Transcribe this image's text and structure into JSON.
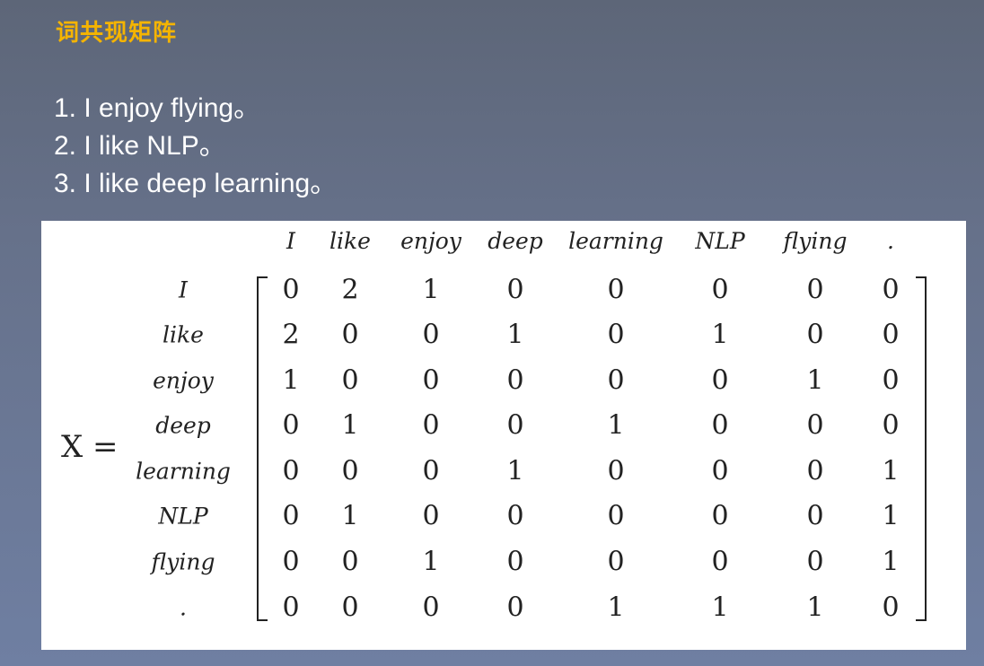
{
  "title": "词共现矩阵",
  "sentences": [
    "1. I enjoy flying。",
    "2. I like NLP。",
    "3. I like deep learning。"
  ],
  "matrix": {
    "symbol": "X =",
    "column_labels": [
      "I",
      "like",
      "enjoy",
      "deep",
      "learning",
      "NLP",
      "flying",
      "."
    ],
    "row_labels": [
      "I",
      "like",
      "enjoy",
      "deep",
      "learning",
      "NLP",
      "flying",
      "."
    ],
    "rows": [
      [
        "0",
        "2",
        "1",
        "0",
        "0",
        "0",
        "0",
        "0"
      ],
      [
        "2",
        "0",
        "0",
        "1",
        "0",
        "1",
        "0",
        "0"
      ],
      [
        "1",
        "0",
        "0",
        "0",
        "0",
        "0",
        "1",
        "0"
      ],
      [
        "0",
        "1",
        "0",
        "0",
        "1",
        "0",
        "0",
        "0"
      ],
      [
        "0",
        "0",
        "0",
        "1",
        "0",
        "0",
        "0",
        "1"
      ],
      [
        "0",
        "1",
        "0",
        "0",
        "0",
        "0",
        "0",
        "1"
      ],
      [
        "0",
        "0",
        "1",
        "0",
        "0",
        "0",
        "0",
        "1"
      ],
      [
        "0",
        "0",
        "0",
        "0",
        "1",
        "1",
        "1",
        "0"
      ]
    ]
  }
}
